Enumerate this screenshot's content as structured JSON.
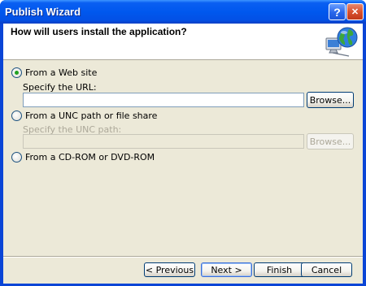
{
  "window": {
    "title": "Publish Wizard",
    "help_glyph": "?",
    "close_glyph": "✕"
  },
  "header": {
    "title": "How will users install the application?",
    "icon": "globe-computer-icon"
  },
  "options": {
    "web": {
      "label": "From a Web site",
      "url_label": "Specify the URL:",
      "url_value": "",
      "browse": "Browse...",
      "selected": true
    },
    "unc": {
      "label": "From a UNC path or file share",
      "unc_label": "Specify the UNC path:",
      "unc_value": "",
      "browse": "Browse...",
      "selected": false
    },
    "cd": {
      "label": "From a CD-ROM or DVD-ROM",
      "selected": false
    }
  },
  "buttons": {
    "previous": "< Previous",
    "next": "Next >",
    "finish": "Finish",
    "cancel": "Cancel"
  },
  "colors": {
    "title_blue": "#0058ee",
    "dialog_face": "#ece9d8",
    "radio_dot": "#21a121"
  }
}
